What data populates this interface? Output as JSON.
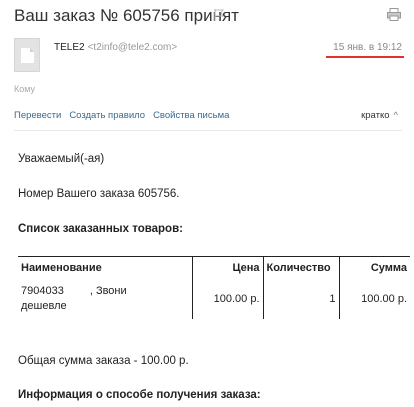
{
  "email": {
    "subject": "Ваш заказ № 605756 принят",
    "sender_name": "TELE2",
    "sender_email": "<t2info@tele2.com>",
    "date": "15 янв. в 19:12",
    "to_label": "Кому",
    "icons": [
      "flag-icon",
      "print-icon",
      "document-icon"
    ],
    "accent_colors": {
      "link": "#3b6a8f",
      "date_underline": "#e0332b"
    }
  },
  "actions": {
    "translate": "Перевести",
    "create_rule": "Создать правило",
    "properties": "Свойства письма",
    "brief": "кратко",
    "brief_chevron": "^"
  },
  "body": {
    "greeting": "Уважаемый(-ая)",
    "order_number": "Номер Вашего заказа 605756.",
    "items_heading": "Список заказанных товаров:",
    "table": {
      "headers": {
        "name": "Наименование",
        "price": "Цена",
        "qty": "Количество",
        "sum": "Сумма"
      },
      "rows": [
        {
          "name_code": "7904033",
          "name_rest": ", Звони",
          "name_line2": "дешевле",
          "price": "100.00 р.",
          "qty": "1",
          "sum": "100.00 р."
        }
      ]
    },
    "total": "Общая сумма заказа - 100.00 р.",
    "delivery_heading": "Информация о способе получения заказа:"
  }
}
